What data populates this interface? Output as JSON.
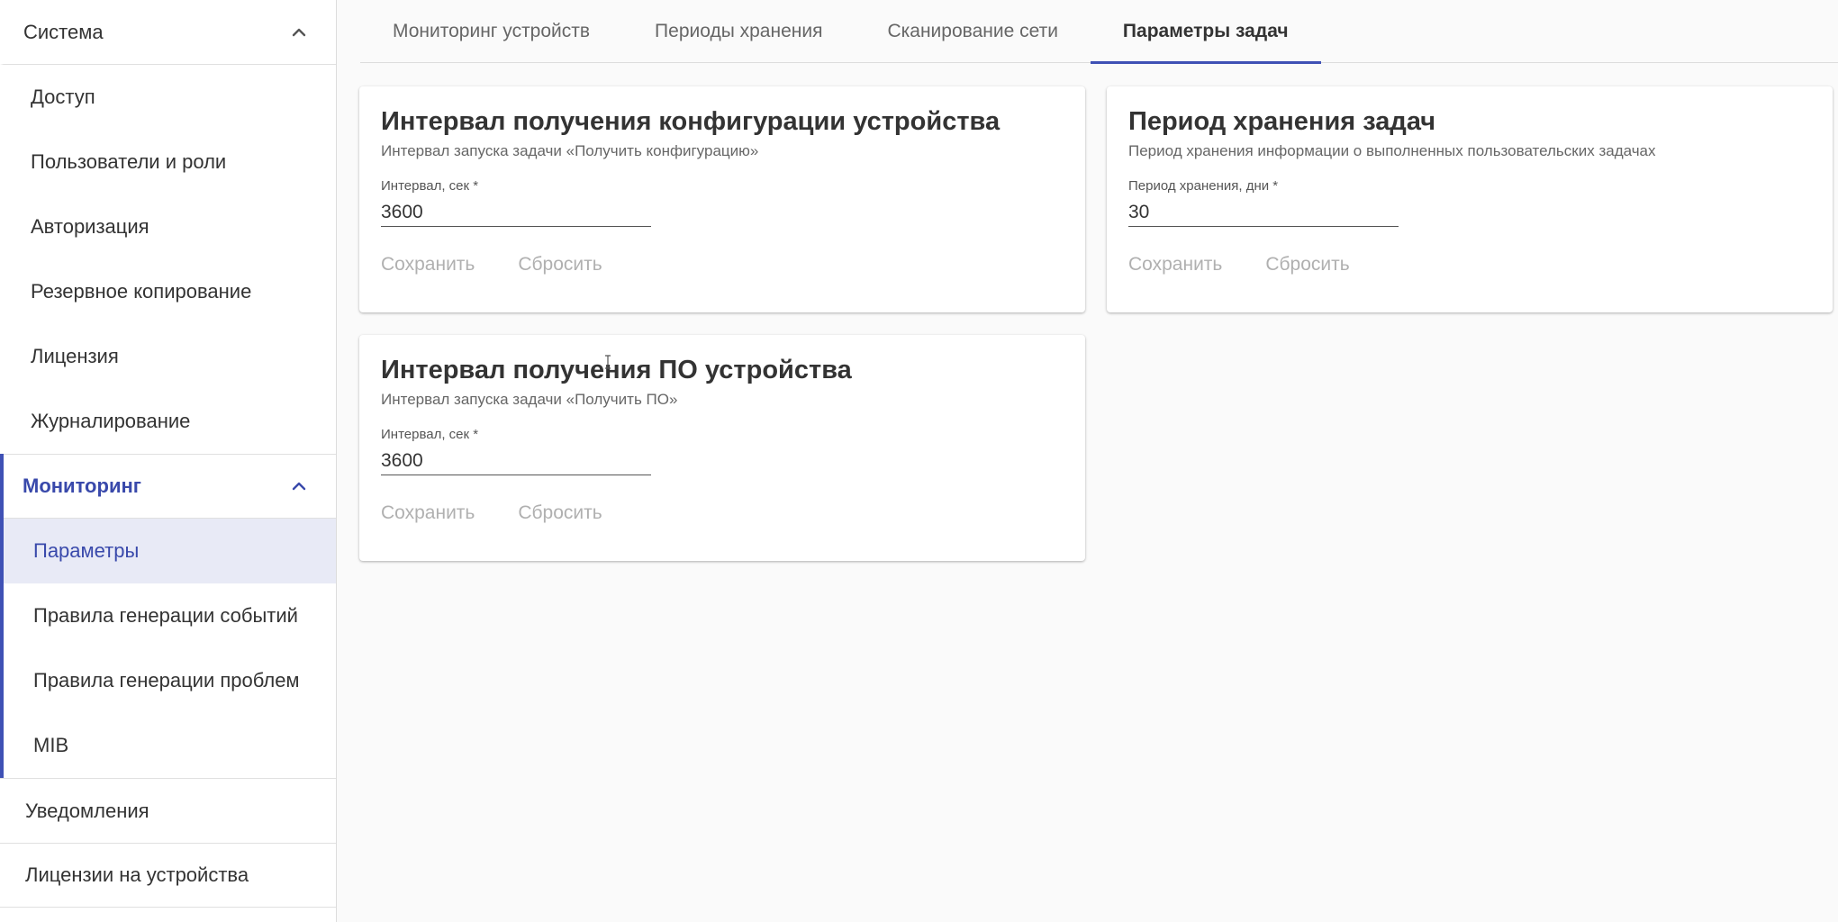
{
  "sidebar": {
    "system": {
      "label": "Система",
      "items": [
        "Доступ",
        "Пользователи и роли",
        "Авторизация",
        "Резервное копирование",
        "Лицензия",
        "Журналирование"
      ]
    },
    "monitoring": {
      "label": "Мониторинг",
      "items": [
        "Параметры",
        "Правила генерации событий",
        "Правила генерации проблем",
        "MIB"
      ],
      "active_item": "Параметры"
    },
    "notifications": "Уведомления",
    "device_licenses": "Лицензии на устройства"
  },
  "tabs": {
    "items": [
      "Мониторинг устройств",
      "Периоды хранения",
      "Сканирование сети",
      "Параметры задач"
    ],
    "active": "Параметры задач"
  },
  "cards": {
    "config_interval": {
      "title": "Интервал получения конфигурации устройства",
      "subtitle": "Интервал запуска задачи «Получить конфигурацию»",
      "field_label": "Интервал, сек *",
      "value": "3600",
      "save_label": "Сохранить",
      "reset_label": "Сбросить"
    },
    "task_retention": {
      "title": "Период хранения задач",
      "subtitle": "Период хранения информации о выполненных пользовательских задачах",
      "field_label": "Период хранения, дни *",
      "value": "30",
      "save_label": "Сохранить",
      "reset_label": "Сбросить"
    },
    "firmware_interval": {
      "title": "Интервал получения ПО устройства",
      "subtitle": "Интервал запуска задачи «Получить ПО»",
      "field_label": "Интервал, сек *",
      "value": "3600",
      "save_label": "Сохранить",
      "reset_label": "Сбросить"
    }
  },
  "icons": {
    "expand_system": "chevron-up-icon",
    "expand_monitoring": "chevron-up-icon"
  },
  "colors": {
    "accent": "#3f51b5",
    "active_bg": "#e8eaf6",
    "disabled_text": "#b0b0b0"
  }
}
